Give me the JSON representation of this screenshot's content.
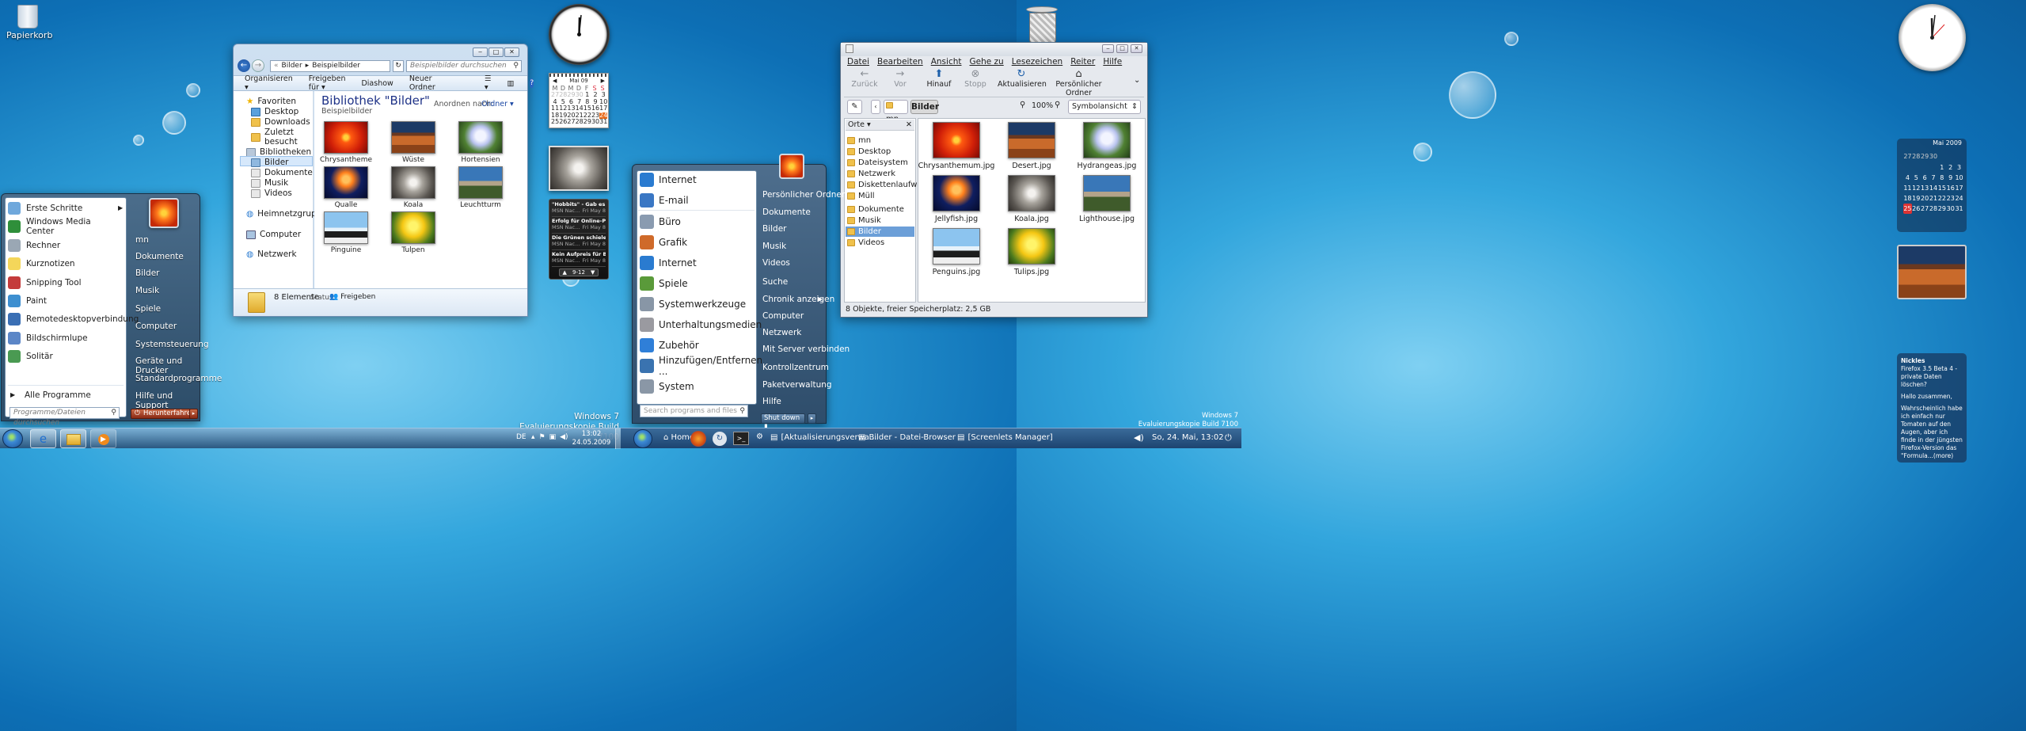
{
  "left_desktop": {
    "recycle_bin_label": "Papierkorb",
    "explorer": {
      "breadcrumb": [
        "Bilder",
        "Beispielbilder"
      ],
      "search_placeholder": "Beispielbilder durchsuchen",
      "toolbar": [
        "Organisieren ▾",
        "Freigeben für ▾",
        "Diashow",
        "Neuer Ordner"
      ],
      "library_title": "Bibliothek \"Bilder\"",
      "library_subtitle": "Beispielbilder",
      "arrange_label": "Anordnen nach:",
      "arrange_value": "Ordner ▾",
      "nav": {
        "favorites": "Favoriten",
        "fav_items": [
          "Desktop",
          "Downloads",
          "Zuletzt besucht"
        ],
        "libraries": "Bibliotheken",
        "lib_items": [
          "Bilder",
          "Dokumente",
          "Musik",
          "Videos"
        ],
        "homegroup": "Heimnetzgruppe",
        "computer": "Computer",
        "network": "Netzwerk"
      },
      "thumbnails": [
        "Chrysantheme",
        "Wüste",
        "Hortensien",
        "Qualle",
        "Koala",
        "Leuchtturm",
        "Pinguine",
        "Tulpen"
      ],
      "status_count": "8 Elemente",
      "status_label": "Status:",
      "status_value": "Freigeben"
    },
    "start_menu": {
      "programs": [
        "Erste Schritte",
        "Windows Media Center",
        "Rechner",
        "Kurznotizen",
        "Snipping Tool",
        "Paint",
        "Remotedesktopverbindung",
        "Bildschirmlupe",
        "Solitär"
      ],
      "all_programs": "Alle Programme",
      "search_placeholder": "Programme/Dateien durchsuchen",
      "right_items": [
        "mn",
        "Dokumente",
        "Bilder",
        "Musik",
        "Spiele",
        "Computer",
        "Systemsteuerung",
        "Geräte und Drucker",
        "Standardprogramme",
        "Hilfe und Support"
      ],
      "shutdown": "Herunterfahren"
    },
    "calendar": {
      "month": "Mai 09",
      "days": [
        "M",
        "D",
        "M",
        "D",
        "F",
        "S",
        "S"
      ],
      "weeks": [
        [
          "27",
          "28",
          "29",
          "30",
          "1",
          "2",
          "3"
        ],
        [
          "4",
          "5",
          "6",
          "7",
          "8",
          "9",
          "10"
        ],
        [
          "11",
          "12",
          "13",
          "14",
          "15",
          "16",
          "17"
        ],
        [
          "18",
          "19",
          "20",
          "21",
          "22",
          "23",
          "24"
        ],
        [
          "25",
          "26",
          "27",
          "28",
          "29",
          "30",
          "31"
        ]
      ]
    },
    "feed": {
      "items": [
        {
          "title": "\"Hobbits\" - Gab es si...",
          "source": "MSN Nac...",
          "date": "Fri May 8"
        },
        {
          "title": "Erfolg für Online-Peti...",
          "source": "MSN Nac...",
          "date": "Fri May 8"
        },
        {
          "title": "Die Grünen schielen ...",
          "source": "MSN Nac...",
          "date": "Fri May 8"
        },
        {
          "title": "Kein Aufpreis für BH...",
          "source": "MSN Nac...",
          "date": "Fri May 8"
        }
      ],
      "pager": "9-12"
    },
    "watermark": [
      "Windows 7",
      "Evaluierungskopie Build 7100"
    ],
    "taskbar": {
      "lang": "DE",
      "time": "13:02",
      "date": "24.05.2009"
    }
  },
  "right_desktop": {
    "dolphin": {
      "menu": [
        "Datei",
        "Bearbeiten",
        "Ansicht",
        "Gehe zu",
        "Lesezeichen",
        "Reiter",
        "Hilfe"
      ],
      "toolbar": [
        "Zurück",
        "Vor",
        "Hinauf",
        "Stopp",
        "Aktualisieren",
        "Persönlicher Ordner"
      ],
      "path": [
        "mn",
        "Bilder"
      ],
      "zoom": "100%",
      "view_mode": "Symbolansicht",
      "places_title": "Orte",
      "places": [
        "mn",
        "Desktop",
        "Dateisystem",
        "Netzwerk",
        "Diskettenlaufwerk",
        "Müll",
        "Dokumente",
        "Musik",
        "Bilder",
        "Videos"
      ],
      "files": [
        "Chrysanthemum.jpg",
        "Desert.jpg",
        "Hydrangeas.jpg",
        "Jellyfish.jpg",
        "Koala.jpg",
        "Lighthouse.jpg",
        "Penguins.jpg",
        "Tulips.jpg"
      ],
      "status": "8 Objekte, freier Speicherplatz: 2,5 GB"
    },
    "kde_menu": {
      "items": [
        "Internet",
        "E-mail",
        "Büro",
        "Grafik",
        "Internet",
        "Spiele",
        "Systemwerkzeuge",
        "Unterhaltungsmedien",
        "Zubehör",
        "Hinzufügen/Entfernen ...",
        "System"
      ],
      "right_items": [
        "Persönlicher Ordner",
        "Dokumente",
        "Bilder",
        "Musik",
        "Videos",
        "Suche",
        "Chronik anzeigen",
        "Computer",
        "Netzwerk",
        "Mit Server verbinden",
        "Kontrollzentrum",
        "Paketverwaltung",
        "Hilfe"
      ],
      "search_placeholder": "Search programs and files",
      "shutdown": "Shut down"
    },
    "calendar": {
      "month": "Mai 2009",
      "weeks": [
        [
          "",
          "",
          "",
          "",
          "1",
          "2",
          "3"
        ],
        [
          "4",
          "5",
          "6",
          "7",
          "8",
          "9",
          "10"
        ],
        [
          "11",
          "12",
          "13",
          "14",
          "15",
          "16",
          "17"
        ],
        [
          "18",
          "19",
          "20",
          "21",
          "22",
          "23",
          "24"
        ],
        [
          "25",
          "26",
          "27",
          "28",
          "29",
          "30",
          "31"
        ]
      ],
      "prev_row": [
        "27",
        "28",
        "29",
        "30"
      ]
    },
    "note": {
      "title": "Nickles",
      "subtitle": "Firefox 3.5 Beta 4 - private Daten löschen?",
      "greeting": "Hallo zusammen,",
      "body": "Wahrscheinlich habe ich einfach nur Tomaten auf den Augen, aber ich finde in der jüngsten Firefox-Version das \"Formula...(more)"
    },
    "watermark": [
      "Windows 7",
      "Evaluierungskopie Build 7100"
    ],
    "taskbar": {
      "home": "Home",
      "tasks": [
        "[Aktualisierungsverwa...",
        "Bilder - Datei-Browser",
        "[Screenlets Manager]"
      ],
      "clock": "So, 24. Mai, 13:02"
    }
  }
}
